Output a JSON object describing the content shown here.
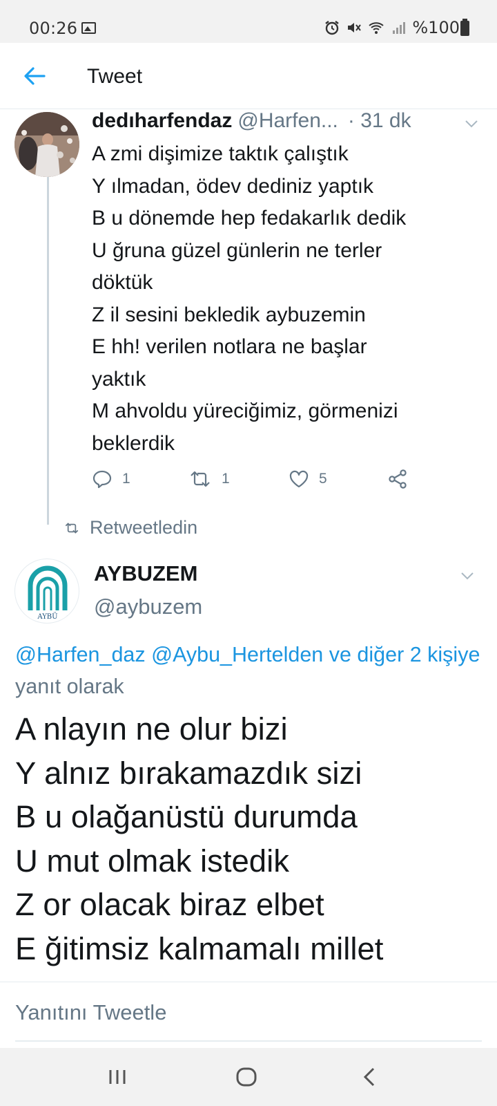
{
  "status_bar": {
    "time": "00:26",
    "battery_text": "%100",
    "icons": [
      "image-icon",
      "alarm-icon",
      "mute-icon",
      "wifi-icon",
      "signal-icon",
      "battery-icon"
    ]
  },
  "header": {
    "title": "Tweet",
    "back_icon": "arrow-left-icon"
  },
  "tweet1": {
    "display_name": "dedıharfendaz",
    "handle": "@Harfen...",
    "time": "· 31 dk",
    "lines": [
      "A zmi dişimize taktık çalıştık",
      "Y ılmadan, ödev dediniz yaptık",
      "B u dönemde hep fedakarlık dedik",
      "U ğruna güzel günlerin ne terler",
      "döktük",
      "Z il sesini bekledik aybuzemin",
      "E hh! verilen notlara ne başlar",
      "yaktık",
      "M ahvoldu yüreciğimiz, görmenizi",
      "beklerdik"
    ],
    "reply_count": "1",
    "retweet_count": "1",
    "like_count": "5"
  },
  "retweet_status": "Retweetledin",
  "tweet2": {
    "display_name": "AYBUZEM",
    "handle": "@aybuzem",
    "reply_to_links": "@Harfen_daz @Aybu_Hertelden ve diğer 2 kişiye",
    "reply_to_suffix": " yanıt olarak",
    "lines": [
      "A nlayın ne olur bizi",
      "Y alnız bırakamazdık sizi",
      "B u olağanüstü durumda",
      "U mut olmak istedik",
      "Z or olacak biraz elbet",
      "E ğitimsiz kalmamalı millet"
    ],
    "logo_text": "AYBÜ"
  },
  "compose": {
    "placeholder": "Yanıtını Tweetle"
  },
  "colors": {
    "accent": "#1da1f2",
    "link": "#1b95e0",
    "secondary_text": "#657786",
    "primary_text": "#14171a",
    "logo_teal": "#1aa0a8"
  }
}
